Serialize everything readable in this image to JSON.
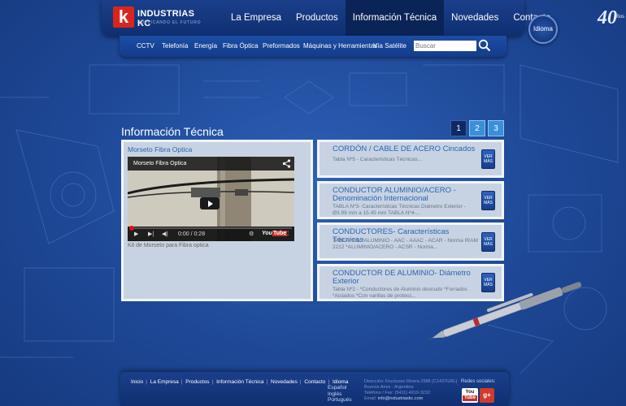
{
  "brand": {
    "name": "INDUSTRIAS KC",
    "tagline": "DUPLICANDO EL FUTURO",
    "logo_letter": "k",
    "anniversary_number": "40",
    "anniversary_text": "años",
    "brand_color": "#d9251d"
  },
  "mainnav": {
    "items": [
      "La Empresa",
      "Productos",
      "Información Técnica",
      "Novedades",
      "Contacto"
    ],
    "active": "Información Técnica"
  },
  "language_button": "Idioma",
  "subnav": {
    "items": [
      "CCTV",
      "Telefonía",
      "Energía",
      "Fibra Óptica",
      "Preformados",
      "Máquinas y Herramientas",
      "Vía Satélite"
    ],
    "search_placeholder": "Buscar"
  },
  "section": {
    "title": "Información Técnica",
    "pages": [
      "1",
      "2",
      "3"
    ],
    "active_page": "1"
  },
  "video": {
    "panel_title": "Morseto Fibra Optica",
    "bar_title": "Morseto Fibra Optica",
    "time": "0:00 / 0:28",
    "youtube_label_a": "You",
    "youtube_label_b": "Tube",
    "caption": "Kit de Morseto para Fibra optica"
  },
  "articles": [
    {
      "title": "CORDÓN / CABLE DE ACERO Cincados",
      "desc": "Tabla Nº5 - Caracteristicas Técnicas...",
      "more": "VER MÁS"
    },
    {
      "title": "CONDUCTOR ALUMINIO/ACERO - Denominación Internacional",
      "desc": "TABLA Nº3- Características Técnicas Diámetro Exterior - Ø3.99 mm a 15.45 mm TABLA Nº4-...",
      "more": "VER MÁS"
    },
    {
      "title": "CONDUCTORES- Características Técnicas",
      "desc": "TABLA Nº1- *ALUMINIO - AAC - AAAC - ACAR - Norma IRAM 2212 *ALUMINIO/ACERO - ACSR - Norma...",
      "more": "VER MÁS"
    },
    {
      "title": "CONDUCTOR DE ALUMINIO- Diámetro Exterior",
      "desc": "Tabla Nº2 - *Conductores de Aluminio desnudo *Forrados *Aislados *Con varillas de protecc...",
      "more": "VER MÁS"
    }
  ],
  "footer": {
    "links": [
      "Inicio",
      "La Empresa",
      "Productos",
      "Información Técnica",
      "Novedades",
      "Contacto",
      "Idioma"
    ],
    "languages": [
      "Español",
      "Inglés",
      "Portugués"
    ],
    "address_lines": [
      "Dirección: Fructuoso Rivera 2588 (C1437GRL)",
      "Buenos Aires - Argentina",
      "Teléfono / Fax: (5411) 4919-3232"
    ],
    "email_label": "Email:",
    "email": "info@industriaskc.com",
    "social_title": "Redes sociales:",
    "youtube_a": "You",
    "youtube_b": "Tube",
    "gplus": "g+"
  }
}
